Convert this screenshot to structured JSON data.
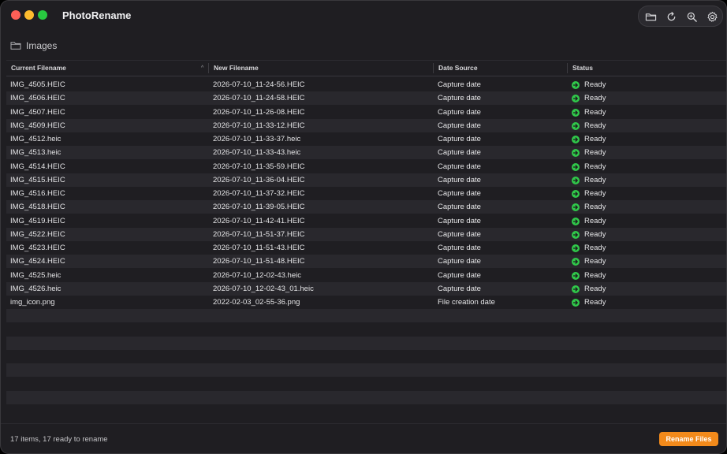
{
  "app": {
    "title": "PhotoRename"
  },
  "toolbar": {
    "buttons": [
      {
        "icon": "folder-icon"
      },
      {
        "icon": "refresh-icon"
      },
      {
        "icon": "zoom-icon"
      },
      {
        "icon": "gear-icon"
      }
    ]
  },
  "path": {
    "folder_name": "Images",
    "icon": "folder-icon"
  },
  "table": {
    "columns": [
      "Current Filename",
      "New Filename",
      "Date Source",
      "Status"
    ],
    "sort_column": "Current Filename",
    "sort_indicator": "^",
    "rows": [
      {
        "current": "IMG_4505.HEIC",
        "new": "2026-07-10_11-24-56.HEIC",
        "source": "Capture date",
        "status": "Ready"
      },
      {
        "current": "IMG_4506.HEIC",
        "new": "2026-07-10_11-24-58.HEIC",
        "source": "Capture date",
        "status": "Ready"
      },
      {
        "current": "IMG_4507.HEIC",
        "new": "2026-07-10_11-26-08.HEIC",
        "source": "Capture date",
        "status": "Ready"
      },
      {
        "current": "IMG_4509.HEIC",
        "new": "2026-07-10_11-33-12.HEIC",
        "source": "Capture date",
        "status": "Ready"
      },
      {
        "current": "IMG_4512.heic",
        "new": "2026-07-10_11-33-37.heic",
        "source": "Capture date",
        "status": "Ready"
      },
      {
        "current": "IMG_4513.heic",
        "new": "2026-07-10_11-33-43.heic",
        "source": "Capture date",
        "status": "Ready"
      },
      {
        "current": "IMG_4514.HEIC",
        "new": "2026-07-10_11-35-59.HEIC",
        "source": "Capture date",
        "status": "Ready"
      },
      {
        "current": "IMG_4515.HEIC",
        "new": "2026-07-10_11-36-04.HEIC",
        "source": "Capture date",
        "status": "Ready"
      },
      {
        "current": "IMG_4516.HEIC",
        "new": "2026-07-10_11-37-32.HEIC",
        "source": "Capture date",
        "status": "Ready"
      },
      {
        "current": "IMG_4518.HEIC",
        "new": "2026-07-10_11-39-05.HEIC",
        "source": "Capture date",
        "status": "Ready"
      },
      {
        "current": "IMG_4519.HEIC",
        "new": "2026-07-10_11-42-41.HEIC",
        "source": "Capture date",
        "status": "Ready"
      },
      {
        "current": "IMG_4522.HEIC",
        "new": "2026-07-10_11-51-37.HEIC",
        "source": "Capture date",
        "status": "Ready"
      },
      {
        "current": "IMG_4523.HEIC",
        "new": "2026-07-10_11-51-43.HEIC",
        "source": "Capture date",
        "status": "Ready"
      },
      {
        "current": "IMG_4524.HEIC",
        "new": "2026-07-10_11-51-48.HEIC",
        "source": "Capture date",
        "status": "Ready"
      },
      {
        "current": "IMG_4525.heic",
        "new": "2026-07-10_12-02-43.heic",
        "source": "Capture date",
        "status": "Ready"
      },
      {
        "current": "IMG_4526.heic",
        "new": "2026-07-10_12-02-43_01.heic",
        "source": "Capture date",
        "status": "Ready"
      },
      {
        "current": "img_icon.png",
        "new": "2022-02-03_02-55-36.png",
        "source": "File creation date",
        "status": "Ready"
      }
    ]
  },
  "footer": {
    "summary": "17 items, 17 ready to rename",
    "rename_label": "Rename Files"
  },
  "colors": {
    "accent": "#f28a1b",
    "status_ready": "#30c94a",
    "window_bg": "#1f1e22",
    "row_alt": "#29282d"
  }
}
